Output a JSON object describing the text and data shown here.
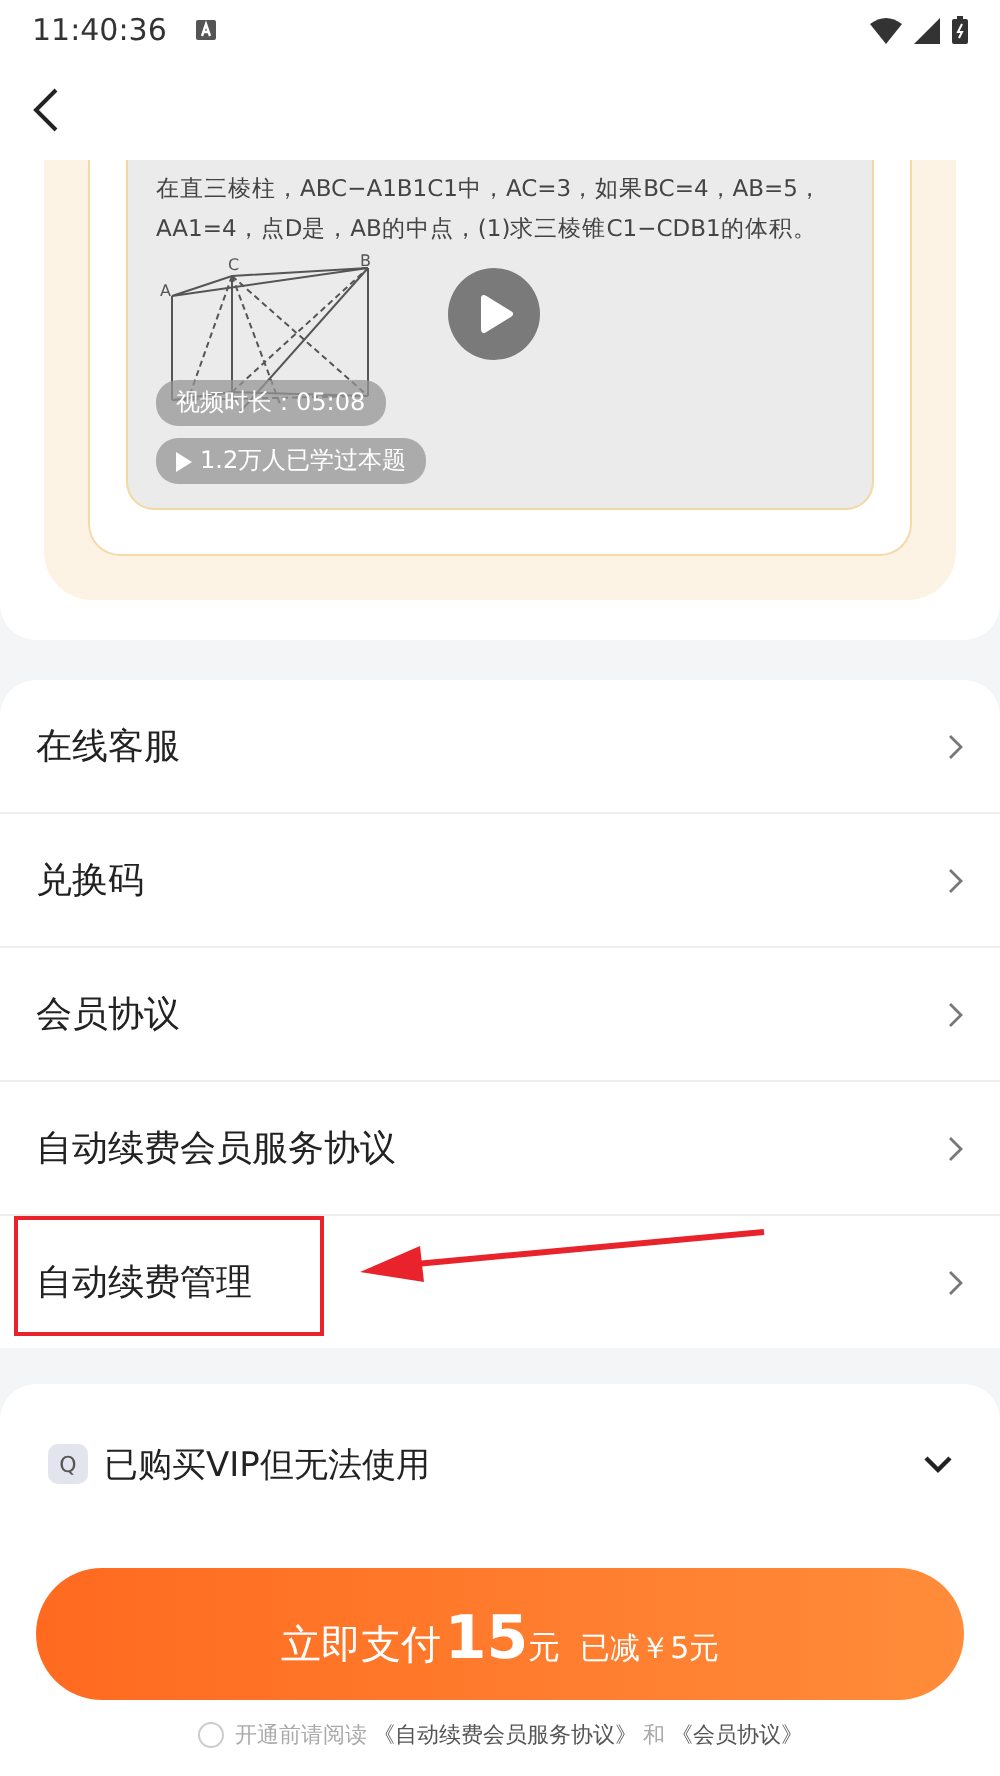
{
  "status_bar": {
    "time": "11:40:36"
  },
  "video_card": {
    "question": "在直三棱柱，ABC−A1B1C1中，AC=3，如果BC=4，AB=5，AA1=4，点D是，AB的中点，(1)求三棱锥C1−CDB1的体积。",
    "duration": "视频时长：05:08",
    "learners": "1.2万人已学过本题",
    "figure_labels": [
      "A",
      "C",
      "B"
    ]
  },
  "menu": [
    {
      "label": "在线客服",
      "highlighted": false
    },
    {
      "label": "兑换码",
      "highlighted": false
    },
    {
      "label": "会员协议",
      "highlighted": false
    },
    {
      "label": "自动续费会员服务协议",
      "highlighted": false
    },
    {
      "label": "自动续费管理",
      "highlighted": true
    }
  ],
  "faq": {
    "badge": "Q",
    "question": "已购买VIP但无法使用",
    "expanded": false
  },
  "pay_button": {
    "label": "立即支付",
    "amount": "15",
    "unit": "元",
    "discount": "已减￥5元"
  },
  "agreement": {
    "checked": false,
    "prefix": "开通前请阅读",
    "link_1": "《自动续费会员服务协议》",
    "joiner": "和",
    "link_2": "《会员协议》"
  }
}
